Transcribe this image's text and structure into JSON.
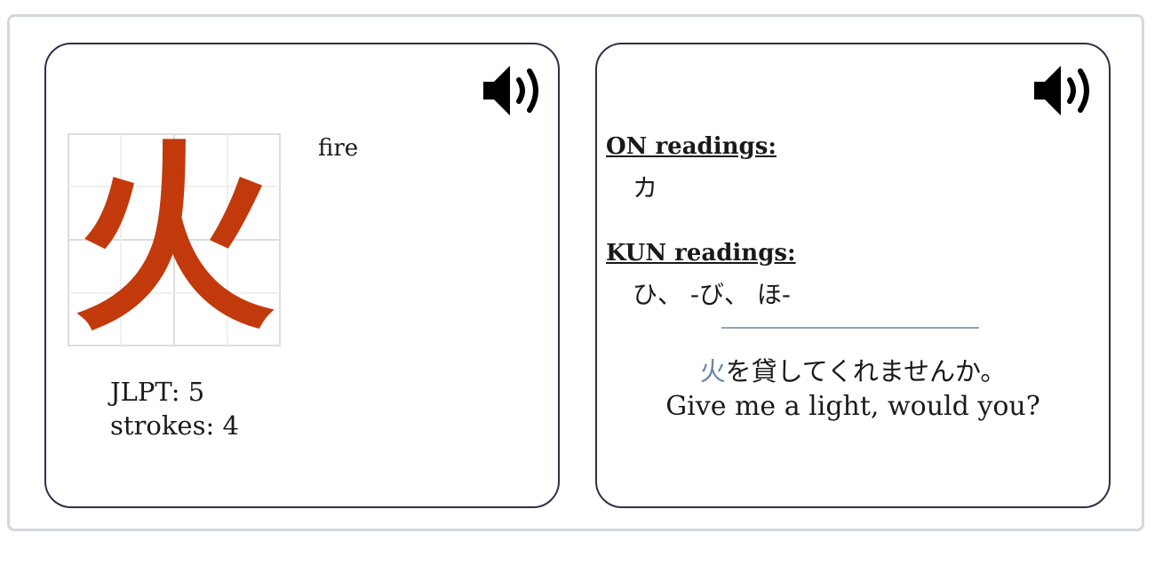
{
  "front": {
    "kanji": "火",
    "meaning": "fire",
    "jlpt_label": "JLPT: 5",
    "strokes_label": "strokes: 4",
    "speaker_icon": "speaker-icon"
  },
  "back": {
    "on_title": "ON readings:",
    "on_values": "カ",
    "kun_title": "KUN readings:",
    "kun_values": "ひ、 -び、 ほ-",
    "example_highlight": "火",
    "example_rest": "を貸してくれませんか。",
    "example_translation": "Give me a light, would you?",
    "speaker_icon": "speaker-icon"
  },
  "colors": {
    "kanji": "#c2390b",
    "highlight": "#6a86ad",
    "card_border": "#2f3049",
    "frame_border": "#d3d8de"
  }
}
